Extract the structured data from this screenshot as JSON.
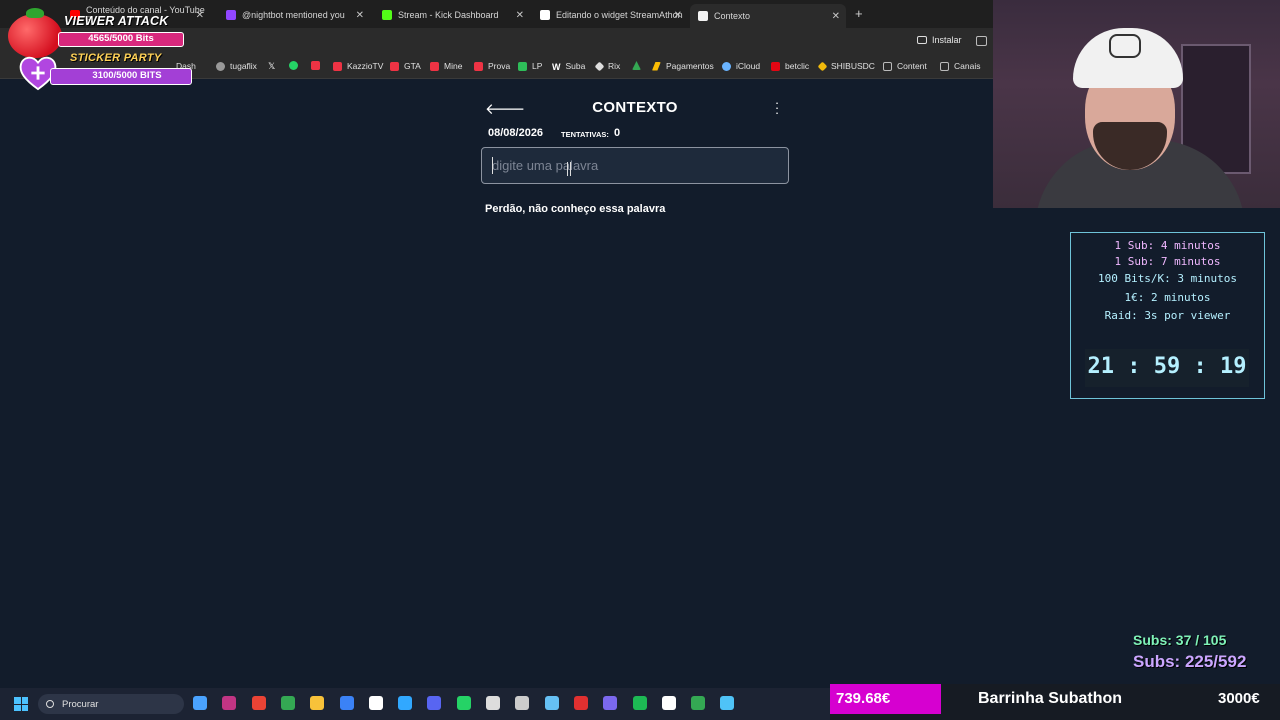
{
  "browser": {
    "tabs": [
      {
        "label": "Conteúdo do canal - YouTube S",
        "fav_color": "#ff0000"
      },
      {
        "label": "@nightbot mentioned you",
        "fav_color": "#9146ff"
      },
      {
        "label": "Stream - Kick Dashboard",
        "fav_color": "#53fc18"
      },
      {
        "label": "Editando o widget StreamAthon",
        "fav_color": "#ffffff"
      },
      {
        "label": "Contexto",
        "fav_color": "#f3f3f3"
      }
    ],
    "install_label": "Instalar",
    "bookmarks": [
      {
        "label": "Dash",
        "color": "#4a90e2"
      },
      {
        "label": "tugaflix",
        "color": "#cccccc"
      },
      {
        "label": "",
        "color": "#ffffff"
      },
      {
        "label": "",
        "color": "#25d366"
      },
      {
        "label": "",
        "color": "#e34"
      },
      {
        "label": "KazzioTV",
        "color": "#e34"
      },
      {
        "label": "GTA",
        "color": "#e34"
      },
      {
        "label": "Mine",
        "color": "#e34"
      },
      {
        "label": "Prova",
        "color": "#e34"
      },
      {
        "label": "LP",
        "color": "#2ebd59"
      },
      {
        "label": "Suba",
        "color": "#ffffff"
      },
      {
        "label": "Rix",
        "color": "#ffffff"
      },
      {
        "label": "",
        "color": "#34a853"
      },
      {
        "label": "Pagamentos",
        "color": "#fbbc04"
      },
      {
        "label": "iCloud",
        "color": "#6ab4ff"
      },
      {
        "label": "betclic",
        "color": "#e30613"
      },
      {
        "label": "SHIBUSDC",
        "color": "#f0b90b"
      },
      {
        "label": "Content",
        "color": "#bbbbbb"
      },
      {
        "label": "Canais",
        "color": "#bbbbbb"
      }
    ]
  },
  "page": {
    "title": "CONTEXTO",
    "date": "08/08/2026",
    "attempts_label": "TENTATIVAS:",
    "attempts_value": "0",
    "input_placeholder": "digite uma palavra",
    "error_message": "Perdão, não conheço essa palavra"
  },
  "overlay": {
    "viewer_attack_title": "VIEWER ATTACK",
    "viewer_attack_progress": "4565/5000 Bits",
    "sticker_party_title": "STICKER PARTY",
    "sticker_party_progress": "3100/5000 BITS",
    "timer_rules": [
      "1 Sub: 4 minutos",
      "1 Sub: 7 minutos",
      "100 Bits/K: 3 minutos",
      "1€: 2 minutos",
      "Raid: 3s por viewer"
    ],
    "clock": "21 : 59 : 19",
    "subs_line1": "Subs: 37 / 105",
    "subs_line2": "Subs: 225/592",
    "donation_amount": "739.68€",
    "donation_bar_name": "Barrinha Subathon",
    "donation_goal": "3000€",
    "donation_progress_fraction": 0.2466
  },
  "taskbar": {
    "search_placeholder": "Procurar",
    "apps": [
      {
        "name": "files-app-icon",
        "color": "#4aa3ff"
      },
      {
        "name": "instagram-app-icon",
        "color": "#c13584"
      },
      {
        "name": "chrome-app-icon",
        "color": "#ea4335"
      },
      {
        "name": "chrome-alt-app-icon",
        "color": "#34a853"
      },
      {
        "name": "folder-app-icon",
        "color": "#f8c23a"
      },
      {
        "name": "calculator-app-icon",
        "color": "#3b82f6"
      },
      {
        "name": "capcut-app-icon",
        "color": "#ffffff"
      },
      {
        "name": "photoshop-app-icon",
        "color": "#31a8ff"
      },
      {
        "name": "discord-app-icon",
        "color": "#5865f2"
      },
      {
        "name": "whatsapp-app-icon",
        "color": "#25d366"
      },
      {
        "name": "epic-app-icon",
        "color": "#dddddd"
      },
      {
        "name": "obs-app-icon",
        "color": "#cccccc"
      },
      {
        "name": "steam-app-icon",
        "color": "#66c0f4"
      },
      {
        "name": "app-red-icon",
        "color": "#e03030"
      },
      {
        "name": "grid-app-icon",
        "color": "#7b68ee"
      },
      {
        "name": "spotify-app-icon",
        "color": "#1db954"
      },
      {
        "name": "capcut2-app-icon",
        "color": "#ffffff"
      },
      {
        "name": "drive-app-icon",
        "color": "#34a853"
      },
      {
        "name": "notepad-app-icon",
        "color": "#4fc3f7"
      }
    ]
  }
}
